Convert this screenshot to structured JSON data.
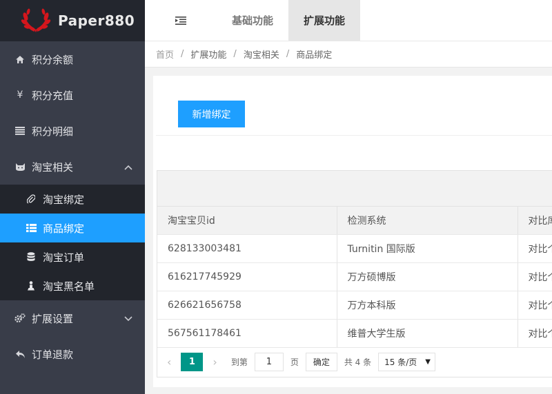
{
  "brand": {
    "name": "Paper880"
  },
  "sidebar": {
    "items": [
      {
        "label": "积分余额",
        "icon": "home-icon"
      },
      {
        "label": "积分充值",
        "icon": "yen-icon"
      },
      {
        "label": "积分明细",
        "icon": "list-icon"
      },
      {
        "label": "淘宝相关",
        "icon": "cat-icon",
        "expanded": true,
        "children": [
          {
            "label": "淘宝绑定",
            "icon": "paperclip-icon"
          },
          {
            "label": "商品绑定",
            "icon": "table-list-icon",
            "active": true
          },
          {
            "label": "淘宝订单",
            "icon": "database-icon"
          },
          {
            "label": "淘宝黑名单",
            "icon": "user-icon"
          }
        ]
      },
      {
        "label": "扩展设置",
        "icon": "gears-icon"
      },
      {
        "label": "订单退款",
        "icon": "reply-icon"
      }
    ]
  },
  "topbar": {
    "tabs": [
      {
        "label": "基础功能",
        "active": false
      },
      {
        "label": "扩展功能",
        "active": true
      }
    ]
  },
  "breadcrumb": [
    "首页",
    "扩展功能",
    "淘宝相关",
    "商品绑定"
  ],
  "actions": {
    "add_label": "新增绑定"
  },
  "table": {
    "columns": [
      "淘宝宝贝id",
      "检测系统",
      "对比库"
    ],
    "rows": [
      [
        "628133003481",
        "Turnitin 国际版",
        "对比个"
      ],
      [
        "616217745929",
        "万方硕博版",
        "对比个"
      ],
      [
        "626621656758",
        "万方本科版",
        "对比个"
      ],
      [
        "567561178461",
        "维普大学生版",
        "对比个"
      ]
    ]
  },
  "pagination": {
    "current_page": "1",
    "jump_label": "到第",
    "jump_value": "1",
    "page_unit": "页",
    "confirm_label": "确定",
    "total": "共 4 条",
    "page_size": "15 条/页"
  },
  "colors": {
    "sidebar_bg": "#393d49",
    "active": "#1e9fff",
    "pager_active": "#009688"
  }
}
